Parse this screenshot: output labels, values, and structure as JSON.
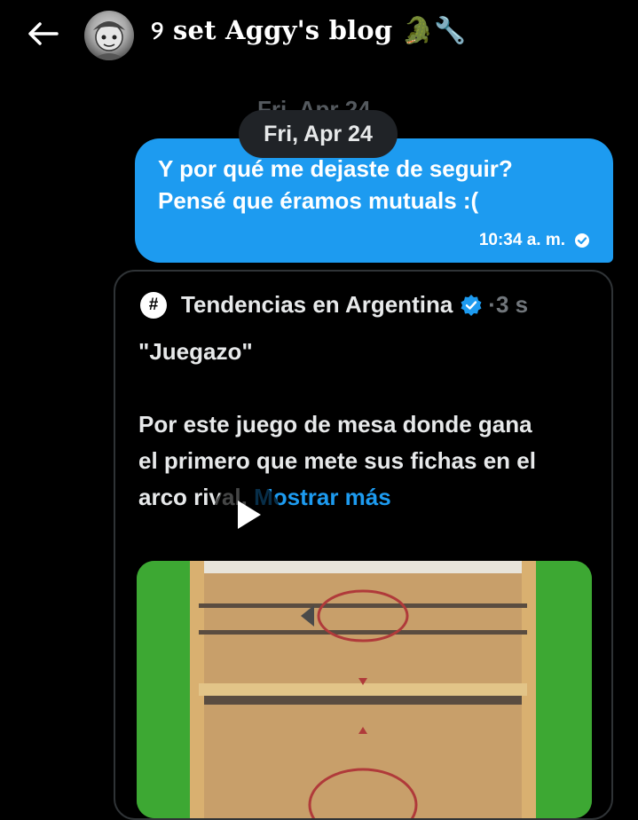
{
  "header": {
    "back_icon": "arrow-left-icon",
    "title": "୨ set Aggy's blog",
    "title_emoji": "🐊🔧"
  },
  "conversation": {
    "ghost_date": "Fri, Apr 24",
    "date_pill": "Fri, Apr 24",
    "message": {
      "line1": "Y por qué me dejaste de seguir?",
      "line2": "Pensé que éramos mutuals :(",
      "time": "10:34 a. m.",
      "status_icon": "sent-check-icon"
    },
    "shared_post": {
      "account": "Tendencias en Argentina",
      "verified_icon": "verified-badge-icon",
      "separator": "·",
      "age": "3 s",
      "quote": "\"Juegazo\"",
      "body": "Por este juego de mesa donde gana el primero que mete sus fichas en el arco rival.",
      "more_link": "Mostrar más",
      "media_icon": "play-icon"
    }
  },
  "colors": {
    "background": "#000000",
    "accent": "#1d9bf0",
    "pill": "#202327",
    "border": "#2f3336",
    "muted": "#71767b"
  }
}
